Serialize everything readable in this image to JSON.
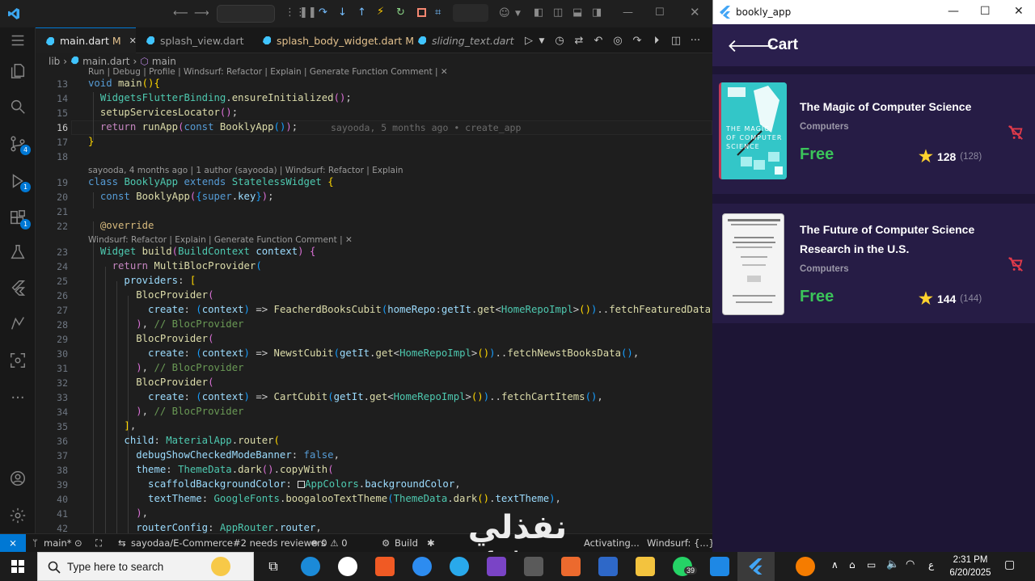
{
  "vscode": {
    "tabs": [
      {
        "label": "main.dart",
        "mod": "M"
      },
      {
        "label": "splash_view.dart",
        "mod": ""
      },
      {
        "label": "splash_body_widget.dart",
        "mod": "M"
      },
      {
        "label": "sliding_text.dart",
        "mod": ""
      }
    ],
    "breadcrumb": {
      "a": "lib",
      "b": "main.dart",
      "c": "main"
    },
    "lens1": "Run | Debug | Profile | Windsurf: Refactor | Explain | Generate Function Comment | ✕",
    "lens2": "sayooda, 4 months ago | 1 author (sayooda) | Windsurf: Refactor | Explain",
    "lens3": "Windsurf: Refactor | Explain | Generate Function Comment | ✕",
    "blame": "sayooda, 5 months ago • create_app",
    "line_numbers": [
      "13",
      "14",
      "15",
      "16",
      "17",
      "18",
      "19",
      "20",
      "21",
      "22",
      "23",
      "24",
      "25",
      "26",
      "27",
      "28",
      "29",
      "30",
      "31",
      "32",
      "33",
      "34",
      "35",
      "36",
      "37",
      "38",
      "39",
      "40",
      "41",
      "42"
    ],
    "status": {
      "branch": "main*",
      "pr": "sayodaa/E-Commerce#2 needs reviewers",
      "problems": "⊗ 0  ⚠ 0",
      "build": "Build",
      "activating": "Activating...",
      "windsurf": "Windsurf: {...}"
    }
  },
  "flutter_app": {
    "window_title": "bookly_app",
    "appbar_title": "Cart",
    "books": [
      {
        "title": "The Magic of Computer Science",
        "author": "Computers",
        "price": "Free",
        "rating": "128",
        "count": "(128)"
      },
      {
        "title": "The Future of Computer Science Research in the U.S.",
        "author": "Computers",
        "price": "Free",
        "rating": "144",
        "count": "(144)"
      }
    ],
    "cover1_text": "THE MAGIC OF COMPUTER SCIENCE"
  },
  "taskbar": {
    "search_placeholder": "Type here to search",
    "time": "2:31 PM",
    "date": "6/20/2025",
    "lang": "ع",
    "whatsapp_badge": "39"
  },
  "watermark": {
    "arabic": "نفذلي",
    "url": "nafezly.com"
  }
}
